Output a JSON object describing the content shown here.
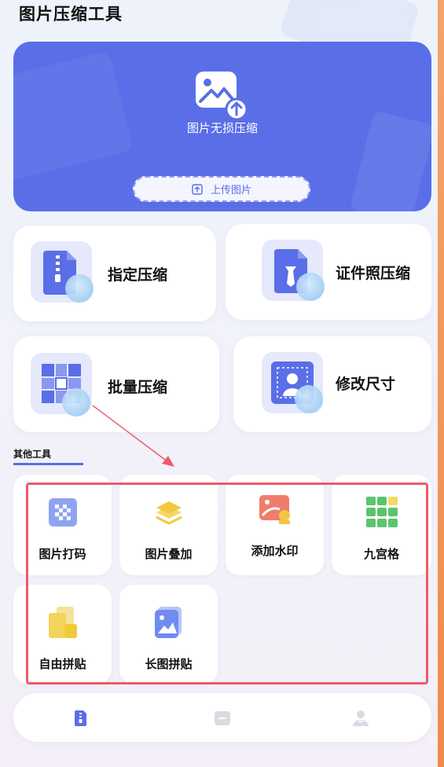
{
  "app": {
    "title": "图片压缩工具"
  },
  "hero": {
    "title": "图片无损压缩",
    "upload_label": "上传图片",
    "icon": "image-upload-icon",
    "background_color": "#5a6ee8"
  },
  "main_tools": [
    {
      "label": "指定压缩",
      "icon": "zip-file-icon"
    },
    {
      "label": "证件照压缩",
      "icon": "id-photo-icon"
    },
    {
      "label": "批量压缩",
      "icon": "batch-grid-icon"
    },
    {
      "label": "修改尺寸",
      "icon": "resize-portrait-icon"
    }
  ],
  "other_tools": {
    "title": "其他工具",
    "items": [
      {
        "label": "图片打码",
        "icon": "mosaic-icon"
      },
      {
        "label": "图片叠加",
        "icon": "layers-icon"
      },
      {
        "label": "添加水印",
        "icon": "watermark-icon"
      },
      {
        "label": "九宫格",
        "icon": "nine-grid-icon"
      },
      {
        "label": "自由拼贴",
        "icon": "free-collage-icon"
      },
      {
        "label": "长图拼贴",
        "icon": "long-image-collage-icon"
      }
    ]
  },
  "bottom_nav": [
    {
      "icon": "compress-tab-icon",
      "active": true
    },
    {
      "icon": "files-tab-icon",
      "active": false
    },
    {
      "icon": "profile-tab-icon",
      "active": false
    }
  ],
  "colors": {
    "accent": "#5a6ee8",
    "annotation_red": "#ee5a6a",
    "edge_orange": "#f08a4b"
  }
}
